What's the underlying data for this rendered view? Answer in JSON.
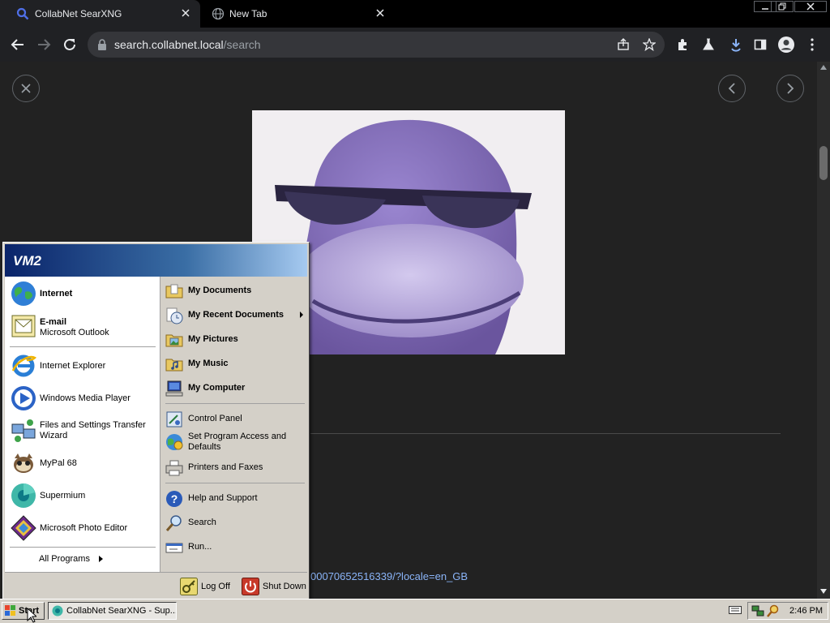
{
  "browser": {
    "tabs": [
      {
        "label": "CollabNet SearXNG",
        "icon": "search-icon",
        "active": true
      },
      {
        "label": "New Tab",
        "icon": "globe-icon",
        "active": false
      }
    ],
    "url_host": "search.collabnet.local",
    "url_path": "/search",
    "accent": "#8ab4f8"
  },
  "page": {
    "link_fragment": "00070652516339/?locale=en_GB"
  },
  "start_menu": {
    "user": "VM2",
    "pinned": [
      {
        "title": "Internet",
        "icon": "globe-icon"
      },
      {
        "title": "E-mail",
        "subtitle": "Microsoft Outlook",
        "icon": "outlook-icon"
      }
    ],
    "recent": [
      {
        "title": "Internet Explorer",
        "icon": "internet-explorer-icon"
      },
      {
        "title": "Windows Media Player",
        "icon": "media-player-icon"
      },
      {
        "title": "Files and Settings Transfer",
        "title2": "Wizard",
        "icon": "transfer-wizard-icon"
      },
      {
        "title": "MyPal 68",
        "icon": "mypal-icon"
      },
      {
        "title": "Supermium",
        "icon": "supermium-icon"
      },
      {
        "title": "Microsoft Photo Editor",
        "icon": "photo-editor-icon"
      }
    ],
    "all_programs": "All Programs",
    "places": [
      {
        "title": "My Documents",
        "icon": "folder-documents-icon"
      },
      {
        "title": "My Recent Documents",
        "icon": "recent-documents-icon",
        "submenu": true
      },
      {
        "title": "My Pictures",
        "icon": "folder-pictures-icon"
      },
      {
        "title": "My Music",
        "icon": "folder-music-icon"
      },
      {
        "title": "My Computer",
        "icon": "computer-icon"
      }
    ],
    "settings": [
      {
        "title": "Control Panel",
        "icon": "control-panel-icon"
      },
      {
        "title": "Set Program Access and",
        "title2": "Defaults",
        "icon": "program-access-icon"
      },
      {
        "title": "Printers and Faxes",
        "icon": "printer-icon"
      }
    ],
    "help": [
      {
        "title": "Help and Support",
        "icon": "help-icon"
      },
      {
        "title": "Search",
        "icon": "search-icon"
      },
      {
        "title": "Run...",
        "icon": "run-icon"
      }
    ],
    "log_off": "Log Off",
    "shut_down": "Shut Down"
  },
  "taskbar": {
    "start": "Start",
    "task": "CollabNet SearXNG - Sup...",
    "clock": "2:46 PM"
  }
}
